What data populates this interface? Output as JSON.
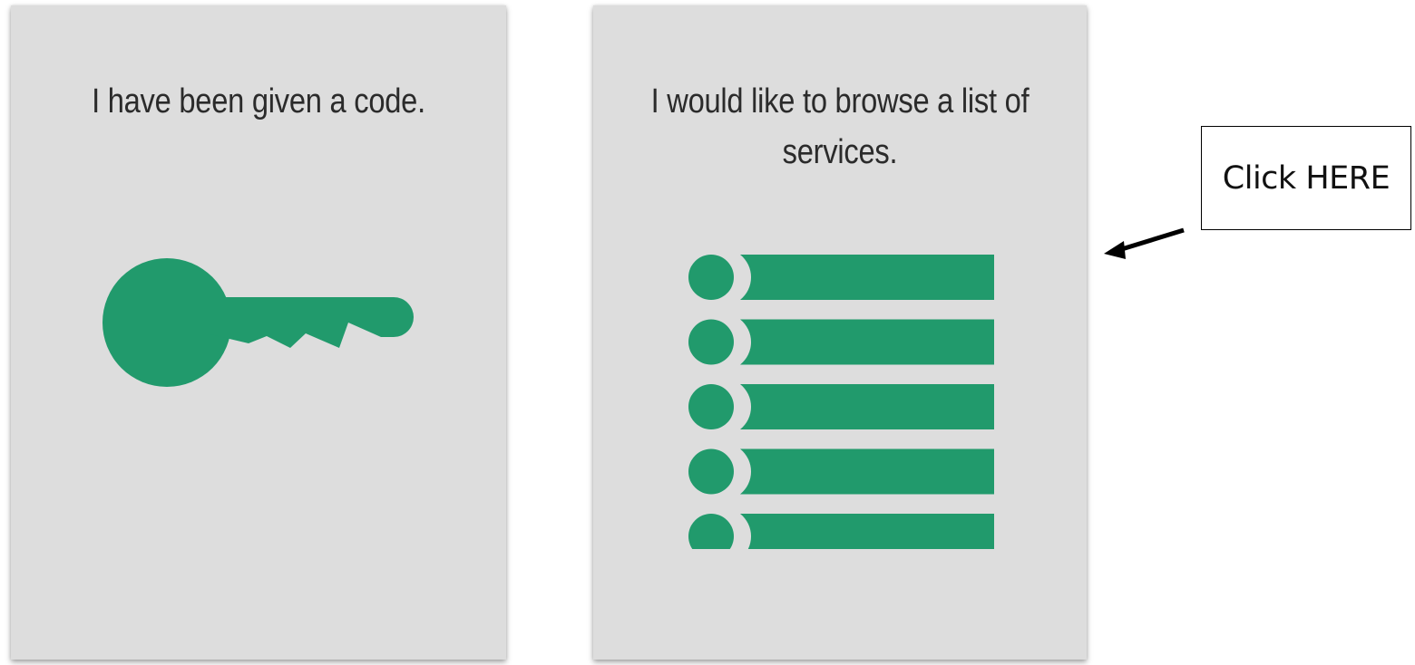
{
  "cards": [
    {
      "text": "I have been given a code.",
      "icon": "key-icon"
    },
    {
      "text": "I would like to browse a list of services.",
      "icon": "list-icon"
    }
  ],
  "callout": {
    "text": "Click HERE",
    "icon": "arrow-icon"
  },
  "colors": {
    "accent": "#219a6c",
    "card_bg": "#dddddd",
    "text": "#2b2b2b"
  }
}
